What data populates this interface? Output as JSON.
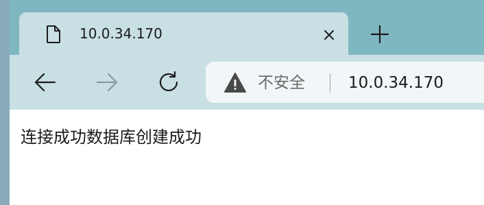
{
  "tab": {
    "icon": "document-icon",
    "title": "10.0.34.170",
    "close_icon": "close-icon"
  },
  "tabstrip": {
    "new_tab_icon": "plus-icon"
  },
  "toolbar": {
    "back_icon": "arrow-left-icon",
    "forward_icon": "arrow-right-icon",
    "reload_icon": "reload-icon"
  },
  "address_bar": {
    "security_icon": "warning-icon",
    "security_label": "不安全",
    "url": "10.0.34.170"
  },
  "page": {
    "message": "连接成功数据库创建成功"
  },
  "colors": {
    "tabstrip": "#7fb7c1",
    "toolbar": "#c8dfe3",
    "forward_disabled": "#8a9aa0"
  }
}
